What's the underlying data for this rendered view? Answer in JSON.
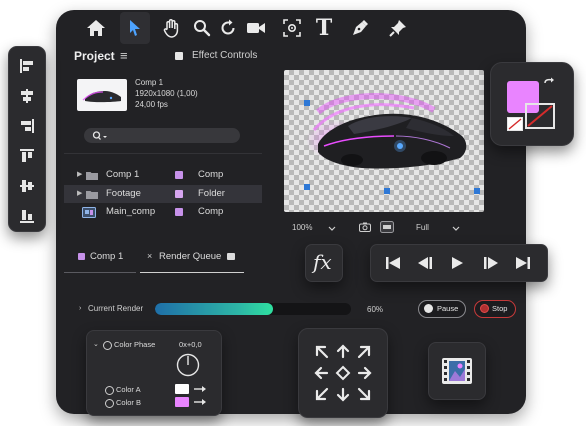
{
  "toolbar": {
    "icons": [
      "home-icon",
      "selection-arrow-icon",
      "hand-icon",
      "zoom-icon",
      "rotate-icon",
      "camera-icon",
      "anchor-point-icon",
      "type-icon",
      "pen-icon",
      "pin-icon"
    ]
  },
  "project": {
    "title": "Project",
    "menu_glyph": "≡",
    "effect_controls": "Effect Controls",
    "comp_info": {
      "name": "Comp 1",
      "size": "1920x1080 (1,00)",
      "fps": "24,00 fps"
    },
    "items": [
      {
        "name": "Comp 1",
        "type": "Comp",
        "color": "#c792ea"
      },
      {
        "name": "Footage",
        "type": "Folder",
        "color": "#d7a6f0"
      },
      {
        "name": "Main_comp",
        "type": "Comp",
        "color": "#c792ea"
      }
    ]
  },
  "viewer": {
    "zoom": "100%",
    "resolution": "Full",
    "accent": "#e94cff"
  },
  "tabs": {
    "comp": "Comp 1",
    "render": "Render Queue",
    "close": "×"
  },
  "render": {
    "label": "Current Render",
    "progress": 0.6,
    "percent": "60%",
    "pause": "Pause",
    "stop": "Stop",
    "bar_color": "#2ed3a2"
  },
  "effect": {
    "label": "Color Phase",
    "value": "0x+0,0",
    "color_a": "Color A",
    "color_b": "Color B"
  },
  "colors": {
    "accent": "#e984ff",
    "panel": "#222225"
  }
}
